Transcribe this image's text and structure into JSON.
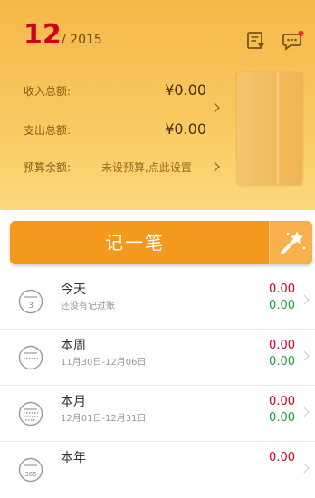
{
  "header": {
    "month": "12",
    "year_text": "/ 2015",
    "icons": [
      "bill-icon",
      "message-icon"
    ],
    "income_label": "收入总额:",
    "income_value": "¥0.00",
    "expense_label": "支出总额:",
    "expense_value": "¥0.00",
    "budget_label": "预算余额:",
    "budget_value": "未设预算,点此设置"
  },
  "record_button": {
    "label": "记一笔"
  },
  "list": [
    {
      "icon_text": "3",
      "title": "今天",
      "subtitle": "还没有记过账",
      "income": "0.00",
      "expense": "0.00"
    },
    {
      "icon_text": "",
      "title": "本周",
      "subtitle": "11月30日-12月06日",
      "income": "0.00",
      "expense": "0.00"
    },
    {
      "icon_text": "",
      "title": "本月",
      "subtitle": "12月01日-12月31日",
      "income": "0.00",
      "expense": "0.00"
    },
    {
      "icon_text": "365",
      "title": "本年",
      "subtitle": "",
      "income": "0.00",
      "expense": ""
    }
  ],
  "colors": {
    "accent": "#f39a1e",
    "income": "#d0021b",
    "expense": "#1e9e3a",
    "header_top": "#f5b84a"
  }
}
